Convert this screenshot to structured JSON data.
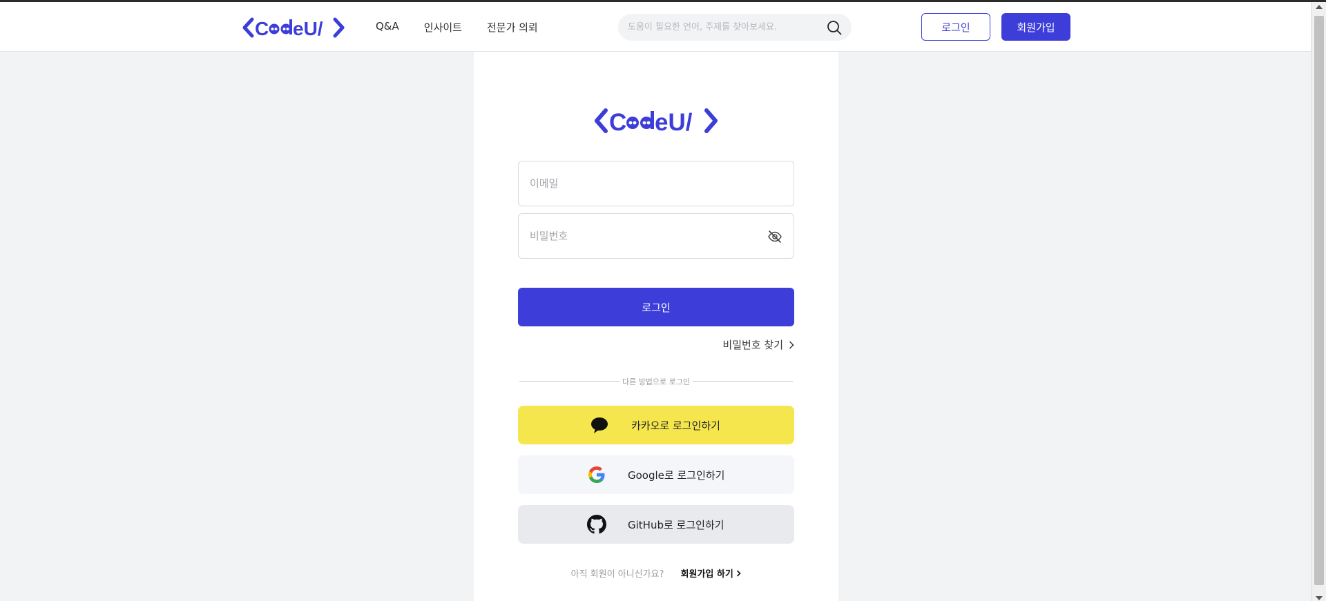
{
  "header": {
    "logo_text": "<CodeU/>",
    "nav": [
      "Q&A",
      "인사이트",
      "전문가 의뢰"
    ],
    "search_placeholder": "도움이 필요한 언어, 주제를 찾아보세요.",
    "login_label": "로그인",
    "signup_label": "회원가입"
  },
  "login": {
    "logo_text": "<CodeU/>",
    "email_placeholder": "이메일",
    "password_placeholder": "비밀번호",
    "login_button": "로그인",
    "find_password": "비밀번호 찾기",
    "divider_text": "다른 방법으로 로그인",
    "kakao_label": "카카오로 로그인하기",
    "google_label": "Google로 로그인하기",
    "github_label": "GitHub로 로그인하기",
    "no_account_text": "아직 회원이 아니신가요?",
    "signup_link": "회원가입 하기"
  },
  "colors": {
    "brand": "#3d3dd9",
    "kakao": "#f5e64e",
    "background": "#f2f3f5"
  },
  "icons": [
    "search-icon",
    "eye-off-icon",
    "chevron-right-icon",
    "kakao-speech-icon",
    "google-icon",
    "github-icon"
  ]
}
